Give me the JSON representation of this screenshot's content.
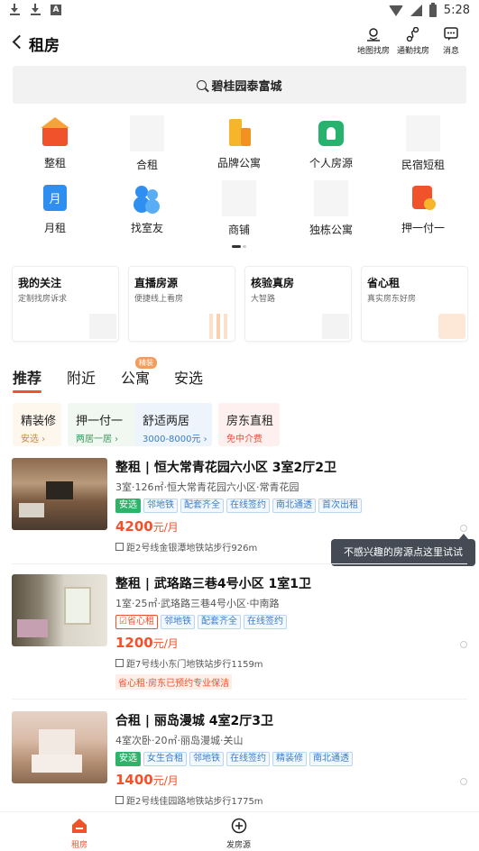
{
  "status_bar": {
    "time": "5:28"
  },
  "header": {
    "title": "租房",
    "actions": [
      {
        "label": "地图找房",
        "icon": "map-pin-icon"
      },
      {
        "label": "通勤找房",
        "icon": "route-icon"
      },
      {
        "label": "消息",
        "icon": "message-icon"
      }
    ]
  },
  "search": {
    "text": "碧桂园泰富城"
  },
  "categories": [
    {
      "label": "整租",
      "icon": "house-icon"
    },
    {
      "label": "合租",
      "icon": "placeholder-icon"
    },
    {
      "label": "品牌公寓",
      "icon": "building-icon"
    },
    {
      "label": "个人房源",
      "icon": "person-house-icon"
    },
    {
      "label": "民宿短租",
      "icon": "placeholder-icon"
    },
    {
      "label": "月租",
      "icon": "calendar-month-icon"
    },
    {
      "label": "找室友",
      "icon": "roommate-icon"
    },
    {
      "label": "商铺",
      "icon": "placeholder-icon"
    },
    {
      "label": "独栋公寓",
      "icon": "placeholder-icon"
    },
    {
      "label": "押一付一",
      "icon": "payment-icon"
    }
  ],
  "feature_cards": [
    {
      "title": "我的关注",
      "subtitle": "定制找房诉求"
    },
    {
      "title": "直播房源",
      "subtitle": "便捷线上看房"
    },
    {
      "title": "核验真房",
      "subtitle": "大智路"
    },
    {
      "title": "省心租",
      "subtitle": "真实房东好房"
    }
  ],
  "tabs": [
    {
      "label": "推荐",
      "active": true
    },
    {
      "label": "附近",
      "active": false
    },
    {
      "label": "公寓",
      "active": false,
      "badge": "精装"
    },
    {
      "label": "安选",
      "active": false
    }
  ],
  "filters": [
    {
      "title": "精装修",
      "subtitle": "安选 ›",
      "bg": "#fdf7ee",
      "sub_color": "#c98a3a"
    },
    {
      "title": "押一付一",
      "subtitle": "两居一居 ›",
      "bg": "#f1f7f1",
      "sub_color": "#3c9a5a"
    },
    {
      "title": "舒适两居",
      "subtitle": "3000-8000元 ›",
      "bg": "#eef4fc",
      "sub_color": "#3a7bc8"
    },
    {
      "title": "房东直租",
      "subtitle": "免中介费",
      "bg": "#fdf0ee",
      "sub_color": "#e0533a"
    }
  ],
  "listings": [
    {
      "title": "整租 | 恒大常青花园六小区 3室2厅2卫",
      "desc": "3室·126㎡·恒大常青花园六小区·常青花园",
      "tags": [
        {
          "text": "安选",
          "style": "green"
        },
        {
          "text": "邻地铁",
          "style": "blue"
        },
        {
          "text": "配套齐全",
          "style": "blue"
        },
        {
          "text": "在线签约",
          "style": "blue"
        },
        {
          "text": "南北通透",
          "style": "blue"
        },
        {
          "text": "首次出租",
          "style": "blue"
        }
      ],
      "price": "4200",
      "price_unit": "元/月",
      "distance": "距2号线金银潭地铁站步行926m",
      "promo": ""
    },
    {
      "title": "整租 | 武珞路三巷4号小区 1室1卫",
      "desc": "1室·25㎡·武珞路三巷4号小区·中南路",
      "tags": [
        {
          "text": "☑省心租",
          "style": "orange"
        },
        {
          "text": "邻地铁",
          "style": "blue"
        },
        {
          "text": "配套齐全",
          "style": "blue"
        },
        {
          "text": "在线签约",
          "style": "blue"
        }
      ],
      "price": "1200",
      "price_unit": "元/月",
      "distance": "距7号线小东门地铁站步行1159m",
      "promo": "省心租·房东已预约专业保洁"
    },
    {
      "title": "合租 | 丽岛漫城 4室2厅3卫",
      "desc": "4室次卧·20㎡·丽岛漫城·关山",
      "tags": [
        {
          "text": "安选",
          "style": "green"
        },
        {
          "text": "女生合租",
          "style": "blue"
        },
        {
          "text": "邻地铁",
          "style": "blue"
        },
        {
          "text": "在线签约",
          "style": "blue"
        },
        {
          "text": "精装修",
          "style": "blue"
        },
        {
          "text": "南北通透",
          "style": "blue"
        }
      ],
      "price": "1400",
      "price_unit": "元/月",
      "distance": "距2号线佳园路地铁站步行1775m",
      "promo": ""
    }
  ],
  "tooltip": {
    "text": "不感兴趣的房源点这里试试"
  },
  "bottom_nav": [
    {
      "label": "租房",
      "active": true,
      "icon": "home-icon"
    },
    {
      "label": "发房源",
      "active": false,
      "icon": "plus-circle-icon"
    }
  ],
  "colors": {
    "accent": "#f0522c",
    "link_blue": "#3a7bc8",
    "green": "#2fb36b"
  }
}
